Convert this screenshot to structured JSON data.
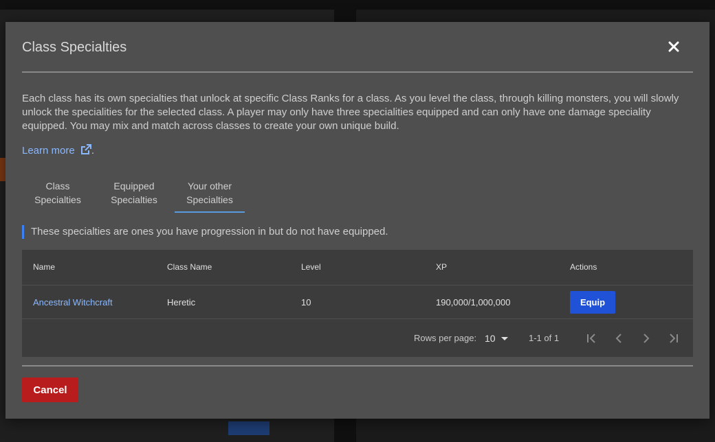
{
  "modal": {
    "title": "Class Specialties",
    "close_label": "×",
    "description": "Each class has its own specialties that unlock at specific Class Ranks for a class. As you level the class, through killing monsters, you will slowly unlock the specialities for the selected class. A player may only have three specialities equipped and can only have one damage speciality equipped. You may mix and match across classes to create your own unique build.",
    "learn_more": "Learn more",
    "learn_more_suffix": ".",
    "tabs": [
      {
        "label_line1": "Class",
        "label_line2": "Specialties",
        "active": false
      },
      {
        "label_line1": "Equipped",
        "label_line2": "Specialties",
        "active": false
      },
      {
        "label_line1": "Your other",
        "label_line2": "Specialties",
        "active": true
      }
    ],
    "callout": "These specialties are ones you have progression in but do not have equipped.",
    "table": {
      "columns": [
        "Name",
        "Class Name",
        "Level",
        "XP",
        "Actions"
      ],
      "rows": [
        {
          "name": "Ancestral Witchcraft",
          "class_name": "Heretic",
          "level": "10",
          "xp": "190,000/1,000,000",
          "action": "Equip"
        }
      ],
      "pagination": {
        "rows_per_page_label": "Rows per page:",
        "rows_per_page": "10",
        "range": "1-1 of 1"
      }
    },
    "cancel_label": "Cancel"
  },
  "colors": {
    "accent_link": "#8ab8ff",
    "equip_button": "#1f52d6",
    "cancel_button": "#b91c1c",
    "tab_indicator": "#5a9be0"
  },
  "icons": [
    "close-icon",
    "external-link-icon",
    "first-page-icon",
    "prev-page-icon",
    "next-page-icon",
    "last-page-icon",
    "caret-down-icon"
  ]
}
